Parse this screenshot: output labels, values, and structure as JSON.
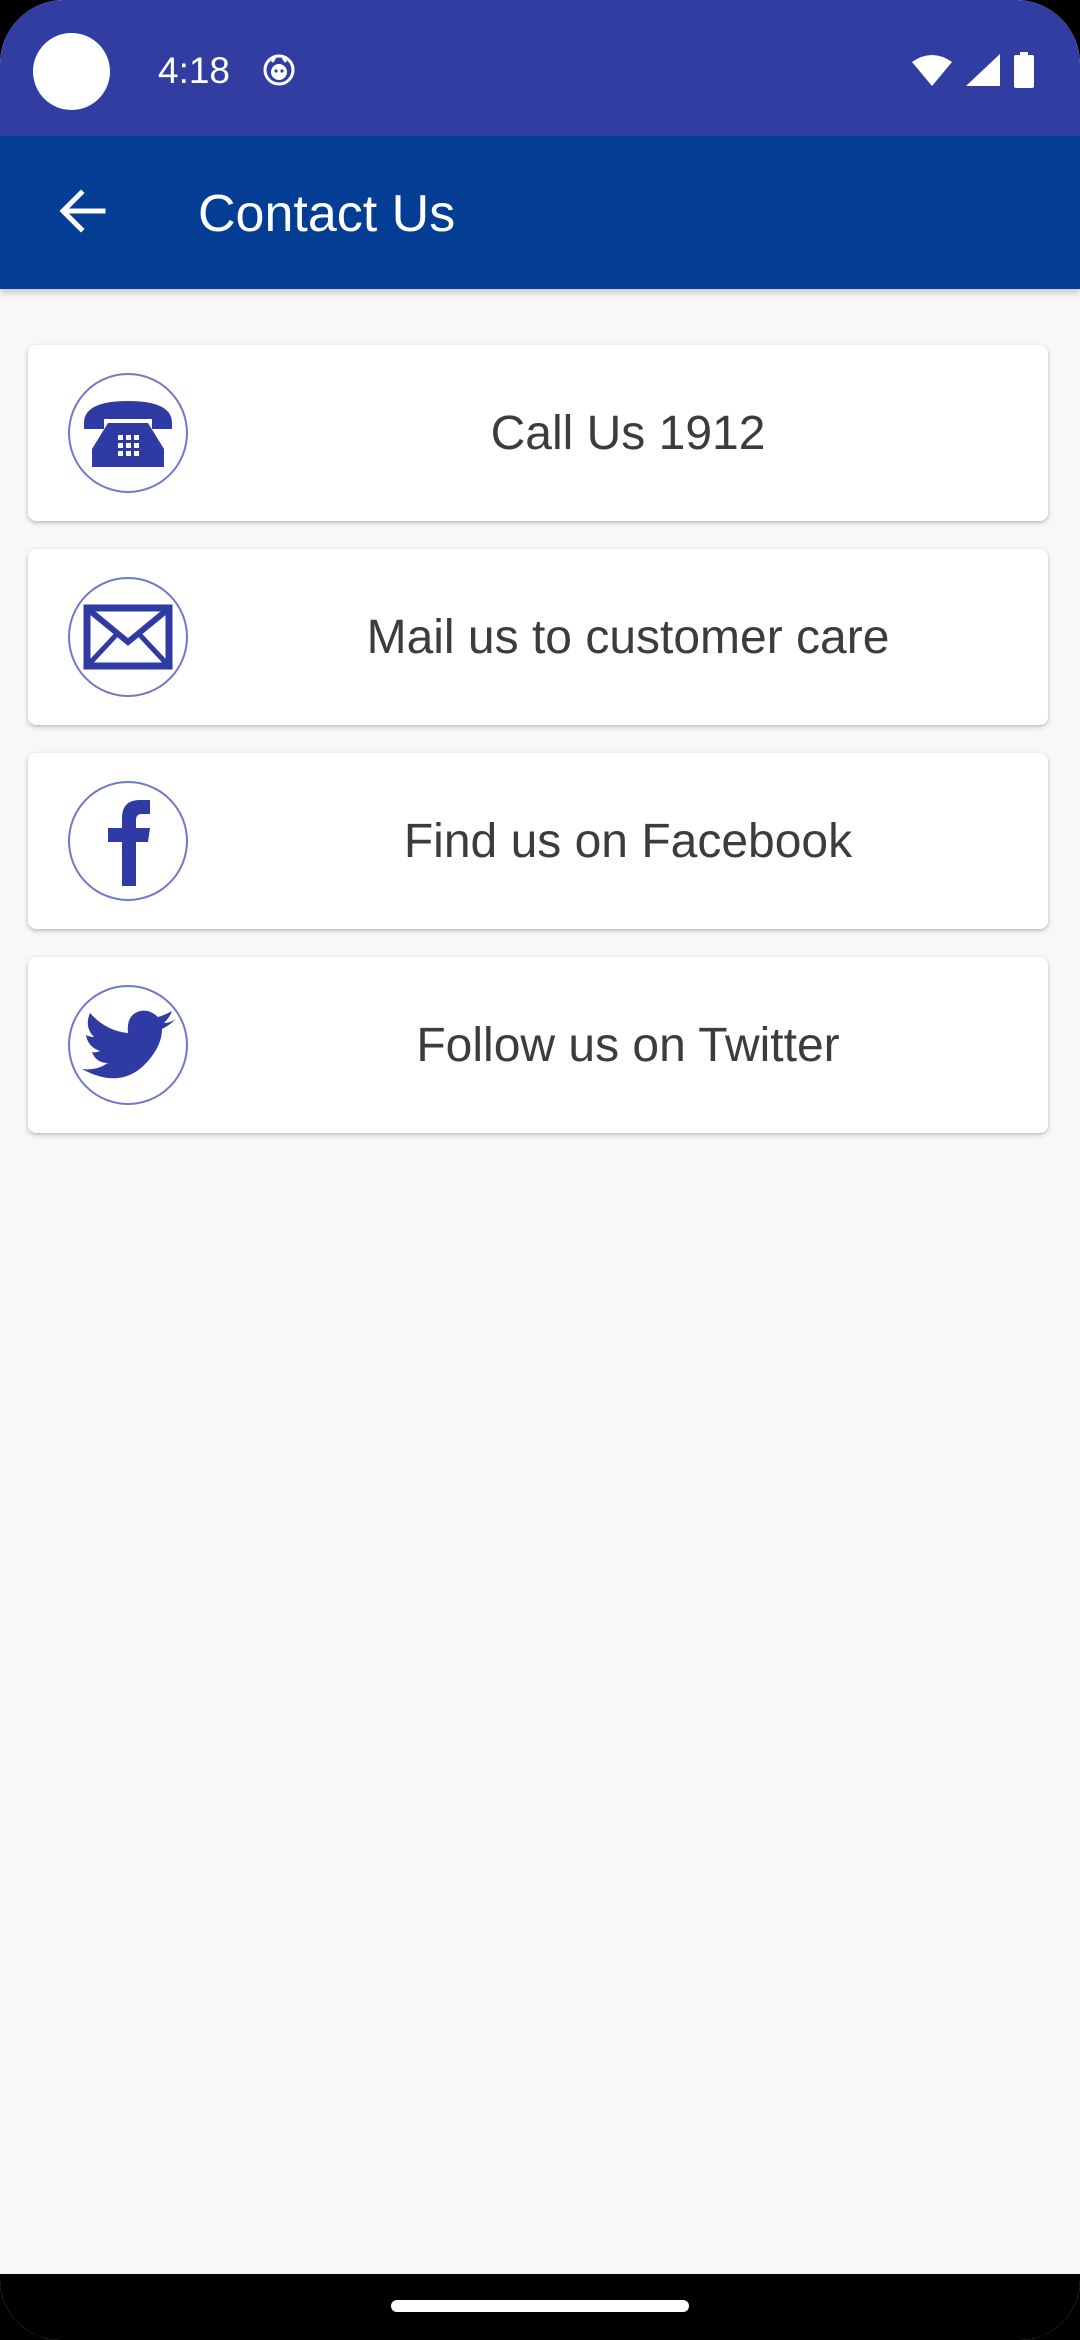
{
  "status_bar": {
    "time": "4:18",
    "icons": [
      "notification-icon",
      "wifi-icon",
      "signal-icon",
      "battery-icon"
    ]
  },
  "app_bar": {
    "title": "Contact Us",
    "back_icon": "back-arrow-icon"
  },
  "contacts": [
    {
      "label": "Call Us 1912",
      "icon": "telephone-icon"
    },
    {
      "label": "Mail us to customer care",
      "icon": "mail-icon"
    },
    {
      "label": "Find us on Facebook",
      "icon": "facebook-icon"
    },
    {
      "label": "Follow us on Twitter",
      "icon": "twitter-icon"
    }
  ],
  "colors": {
    "status_bar": "#323da1",
    "app_bar": "#033e94",
    "icon_blue": "#2f3aa5",
    "background": "#f8f8f8"
  }
}
